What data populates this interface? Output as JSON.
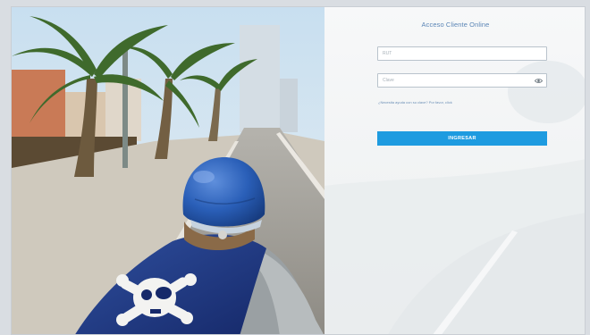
{
  "login": {
    "title": "Acceso Cliente Online",
    "rut_placeholder": "RUT",
    "password_placeholder": "Clave",
    "forgot_link": "¿Necesita ayuda con su clave? Por favor, click",
    "submit_label": "INGRESAR"
  },
  "icons": {
    "password_toggle": "eye-icon"
  },
  "colors": {
    "accent": "#1e9be0",
    "title": "#5b86b6",
    "link": "#6c8fb6",
    "panel_bg": "#f3f4f5"
  }
}
